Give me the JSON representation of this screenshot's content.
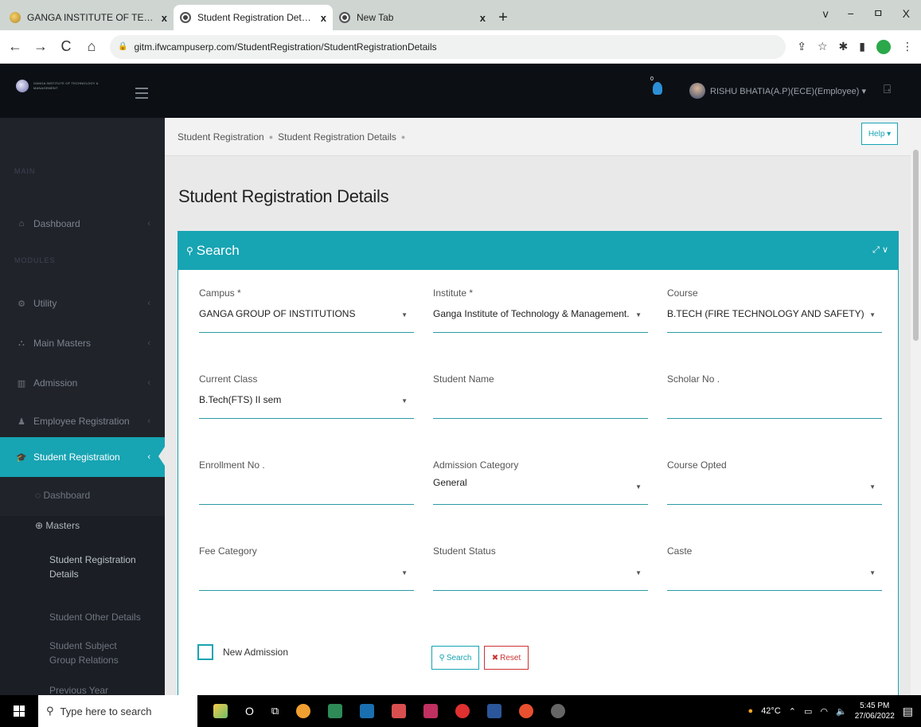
{
  "browser": {
    "tabs": [
      {
        "title": "GANGA INSTITUTE OF TECHNOLOGY",
        "close": "x"
      },
      {
        "title": "Student Registration Details - IFW",
        "close": "x"
      },
      {
        "title": "New Tab",
        "close": "x"
      }
    ],
    "new_tab": "+",
    "window_controls": {
      "chevron": "v",
      "minimize": "−",
      "restore": "ㅁ",
      "close": "X"
    },
    "url": "gitm.ifwcampuserp.com/StudentRegistration/StudentRegistrationDetails"
  },
  "app": {
    "logo_text": "GANGA INSTITUTE OF TECHNOLOGY & MANAGEMENT",
    "notification_count": "0",
    "user": "RISHU BHATIA(A.P)(ECE)(Employee) ▾"
  },
  "sidebar": {
    "section_main": "MAIN",
    "section_modules": "MODULES",
    "items": [
      {
        "label": "Dashboard",
        "icon": "home-icon"
      },
      {
        "label": "Utility",
        "icon": "gear-icon"
      },
      {
        "label": "Main Masters",
        "icon": "sitemap-icon"
      },
      {
        "label": "Admission",
        "icon": "building-icon"
      },
      {
        "label": "Employee Registration",
        "icon": "user-icon"
      },
      {
        "label": "Student Registration",
        "icon": "graduation-cap-icon"
      }
    ],
    "sub_items": [
      {
        "label": "Dashboard"
      },
      {
        "label": "Masters"
      },
      {
        "label": "Student Registration Details"
      },
      {
        "label": "Student Other Details"
      },
      {
        "label": "Student Subject Group Relations"
      },
      {
        "label": "Previous Year"
      }
    ]
  },
  "breadcrumb": {
    "items": [
      "Student Registration",
      "Student Registration Details"
    ],
    "help": "Help ▾"
  },
  "page_title": "Student Registration Details",
  "search_panel": {
    "title": "Search",
    "fields": {
      "campus": {
        "label": "Campus *",
        "value": "GANGA GROUP OF INSTITUTIONS"
      },
      "institute": {
        "label": "Institute *",
        "value": "Ganga Institute of Technology & Management."
      },
      "course": {
        "label": "Course",
        "value": "B.TECH (FIRE TECHNOLOGY AND SAFETY)"
      },
      "current_class": {
        "label": "Current Class",
        "value": "B.Tech(FTS) II sem"
      },
      "student_name": {
        "label": "Student Name",
        "value": ""
      },
      "scholar_no": {
        "label": "Scholar No .",
        "value": ""
      },
      "enrollment_no": {
        "label": "Enrollment No .",
        "value": ""
      },
      "admission_category": {
        "label": "Admission Category",
        "value": "General"
      },
      "course_opted": {
        "label": "Course Opted",
        "value": ""
      },
      "fee_category": {
        "label": "Fee Category",
        "value": ""
      },
      "student_status": {
        "label": "Student Status",
        "value": ""
      },
      "caste": {
        "label": "Caste",
        "value": ""
      }
    },
    "new_admission_label": "New Admission",
    "search_button": "Search",
    "reset_button": "Reset"
  },
  "taskbar": {
    "search_placeholder": "Type here to search",
    "weather": "42°C",
    "time": "5:45 PM",
    "date": "27/06/2022"
  },
  "colors": {
    "accent": "#17a4b3",
    "sidebar_bg": "#20232a",
    "header_bg": "#0c1015",
    "reset": "#cc3333"
  }
}
